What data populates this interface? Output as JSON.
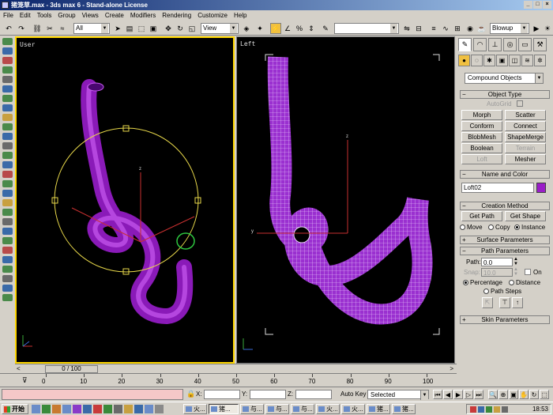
{
  "window": {
    "title": "猪笼草.max - 3ds max 6 - Stand-alone License"
  },
  "menu": [
    "File",
    "Edit",
    "Tools",
    "Group",
    "Views",
    "Create",
    "Modifiers",
    "Rendering",
    "Customize",
    "Help"
  ],
  "toolbar": {
    "selection_filter": "All",
    "coord_system": "View",
    "named_selection": "",
    "render_type": "Blowup"
  },
  "viewports": {
    "user_label": "User",
    "left_label": "Left"
  },
  "command_panel": {
    "category": "Compound Objects",
    "object_type_title": "Object Type",
    "autogrid_label": "AutoGrid",
    "buttons": [
      "Morph",
      "Scatter",
      "Conform",
      "Connect",
      "BlobMesh",
      "ShapeMerge",
      "Boolean",
      "Terrain",
      "Loft",
      "Mesher"
    ],
    "name_color_title": "Name and Color",
    "object_name": "Loft02",
    "object_color": "#9a1ec8",
    "creation_method_title": "Creation Method",
    "get_path": "Get Path",
    "get_shape": "Get Shape",
    "move_label": "Move",
    "copy_label": "Copy",
    "instance_label": "Instance",
    "surface_params_title": "Surface Parameters",
    "path_params_title": "Path Parameters",
    "path_label": "Path:",
    "path_value": "0.0",
    "snap_label": "Snap:",
    "snap_value": "10.0",
    "on_label": "On",
    "percentage_label": "Percentage",
    "distance_label": "Distance",
    "path_steps_label": "Path Steps",
    "skin_params_title": "Skin Parameters"
  },
  "timeline": {
    "slider": "0 / 100",
    "ticks": [
      "0",
      "10",
      "20",
      "30",
      "40",
      "50",
      "60",
      "70",
      "80",
      "90",
      "100"
    ]
  },
  "status": {
    "x_label": "X:",
    "y_label": "Y:",
    "z_label": "Z:",
    "autokey_label": "Auto Key",
    "autokey_value": "Selected"
  },
  "taskbar": {
    "start": "开始",
    "items": [
      "猪...",
      "与...",
      "与...",
      "与...",
      "火...",
      "火...",
      "猪...",
      "猪..."
    ],
    "clock": "18:53"
  },
  "colors": {
    "tube": "#9a1ec8",
    "gizmo": "#e8d84a",
    "active_border": "#ffd700"
  }
}
